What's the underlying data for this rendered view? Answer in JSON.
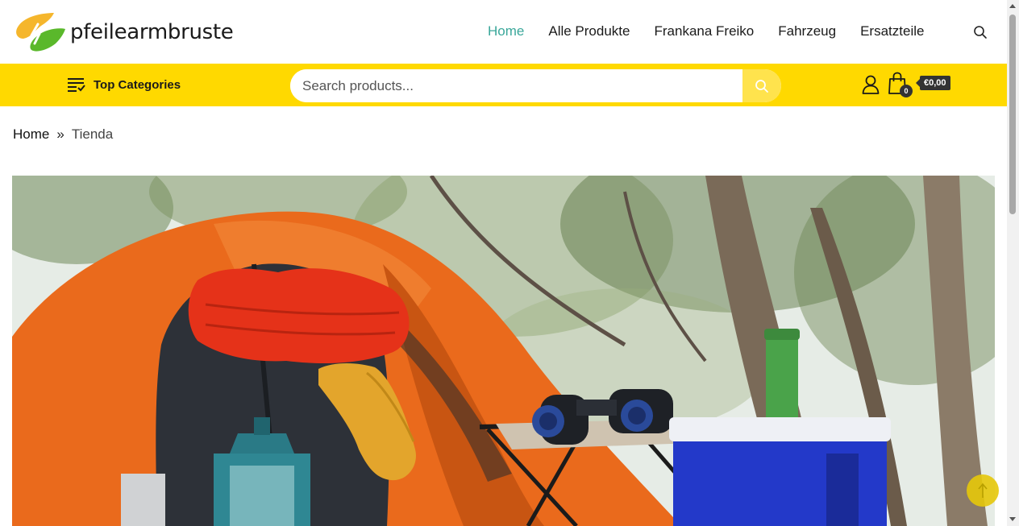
{
  "header": {
    "logo_text": "pfeilearmbruste",
    "nav": [
      {
        "label": "Home",
        "active": true
      },
      {
        "label": "Alle Produkte",
        "active": false
      },
      {
        "label": "Frankana Freiko",
        "active": false
      },
      {
        "label": "Fahrzeug",
        "active": false
      },
      {
        "label": "Ersatzteile",
        "active": false
      }
    ],
    "search_icon": "search-icon"
  },
  "bar": {
    "top_categories_label": "Top Categories",
    "search_placeholder": "Search products...",
    "cart_count": "0",
    "cart_price": "€0,00"
  },
  "breadcrumb": {
    "home": "Home",
    "separator": "»",
    "current": "Tienda"
  },
  "colors": {
    "accent": "#3aa79a",
    "bar_yellow": "#ffd900",
    "dark": "#333333"
  },
  "hero": {
    "description_icon": "camping-photo"
  }
}
